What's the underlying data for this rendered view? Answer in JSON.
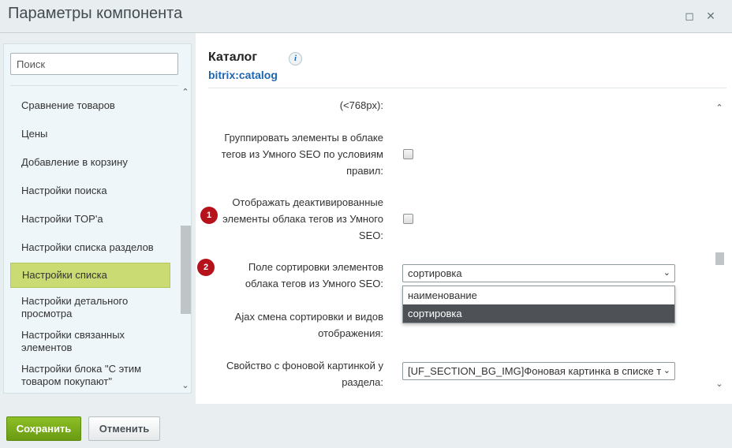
{
  "window": {
    "title": "Параметры компонента"
  },
  "sidebar": {
    "search_placeholder": "Поиск",
    "items": [
      {
        "label": "Сравнение товаров"
      },
      {
        "label": "Цены"
      },
      {
        "label": "Добавление в корзину"
      },
      {
        "label": "Настройки поиска"
      },
      {
        "label": "Настройки TOP'а"
      },
      {
        "label": "Настройки списка разделов"
      },
      {
        "label": "Настройки списка",
        "active": true
      },
      {
        "label": "Настройки детального просмотра"
      },
      {
        "label": "Настройки связанных элементов"
      },
      {
        "label": "Настройки блока \"С этим товаром покупают\""
      }
    ]
  },
  "main": {
    "title": "Каталог",
    "code": "bitrix:catalog",
    "fields": [
      {
        "label": "(<768px):"
      },
      {
        "label": "Группировать элементы в облаке тегов из Умного SEO по условиям правил:",
        "checked": false
      },
      {
        "label": "Отображать деактивированные элементы облака тегов из Умного SEO:",
        "checked": false,
        "badge": "1"
      },
      {
        "label": "Поле сортировки элементов облака тегов из Умного SEO:",
        "value": "сортировка",
        "badge": "2"
      },
      {
        "label": "Ajax смена сортировки и видов отображения:"
      },
      {
        "label": "Свойство с фоновой картинкой у раздела:",
        "value": "[UF_SECTION_BG_IMG]Фоновая картинка в списке т"
      }
    ],
    "dropdown_options": [
      {
        "label": "наименование"
      },
      {
        "label": "сортировка",
        "selected": true
      }
    ]
  },
  "footer": {
    "save_label": "Сохранить",
    "cancel_label": "Отменить"
  },
  "colors": {
    "active_item": "#c9db72",
    "save_button": "#7aad1b",
    "badge": "#b5121b",
    "link": "#2067b0"
  }
}
